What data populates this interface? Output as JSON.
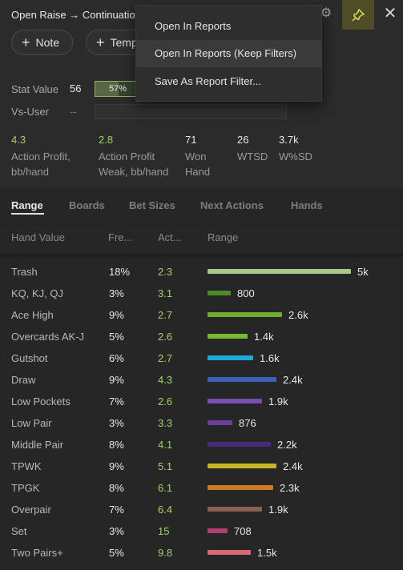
{
  "header": {
    "title": "Open Raise → Continuation",
    "note_label": "Note",
    "template_label": "Temp"
  },
  "context_menu": {
    "items": [
      "Open In Reports",
      "Open In Reports (Keep Filters)",
      "Save As Report Filter..."
    ]
  },
  "stat": {
    "stat_value_label": "Stat Value",
    "stat_value": "56",
    "percent_text": "57% w",
    "percent": 57,
    "vs_user_label": "Vs-User",
    "vs_user_value": "--"
  },
  "kpis": [
    {
      "value": "4.3",
      "label_line1": "Action Profit,",
      "label_line2": "bb/hand"
    },
    {
      "value": "2.8",
      "label_line1": "Action Profit",
      "label_line2": "Weak, bb/hand"
    },
    {
      "value": "71",
      "label_line1": "Won",
      "label_line2": "Hand"
    },
    {
      "value": "26",
      "label_line1": "WTSD",
      "label_line2": ""
    },
    {
      "value": "3.7k",
      "label_line1": "W%SD",
      "label_line2": ""
    }
  ],
  "tabs": [
    "Range",
    "Boards",
    "Bet Sizes",
    "Next Actions",
    "Hands"
  ],
  "table": {
    "headers": [
      "Hand Value",
      "Fre...",
      "Act...",
      "Range"
    ],
    "rows": [
      {
        "name": "Trash",
        "freq": "18%",
        "act": "2.3",
        "count": "5k",
        "value": 5000,
        "color": "#a6c98a"
      },
      {
        "name": "KQ, KJ, QJ",
        "freq": "3%",
        "act": "3.1",
        "count": "800",
        "value": 800,
        "color": "#4c8a2a"
      },
      {
        "name": "Ace High",
        "freq": "9%",
        "act": "2.7",
        "count": "2.6k",
        "value": 2600,
        "color": "#6fae2c"
      },
      {
        "name": "Overcards AK-J",
        "freq": "5%",
        "act": "2.6",
        "count": "1.4k",
        "value": 1400,
        "color": "#7ab832"
      },
      {
        "name": "Gutshot",
        "freq": "6%",
        "act": "2.7",
        "count": "1.6k",
        "value": 1600,
        "color": "#1fa8d8"
      },
      {
        "name": "Draw",
        "freq": "9%",
        "act": "4.3",
        "count": "2.4k",
        "value": 2400,
        "color": "#3a62b8"
      },
      {
        "name": "Low Pockets",
        "freq": "7%",
        "act": "2.6",
        "count": "1.9k",
        "value": 1900,
        "color": "#7a4fb0"
      },
      {
        "name": "Low Pair",
        "freq": "3%",
        "act": "3.3",
        "count": "876",
        "value": 876,
        "color": "#6a3fa0"
      },
      {
        "name": "Middle Pair",
        "freq": "8%",
        "act": "4.1",
        "count": "2.2k",
        "value": 2200,
        "color": "#4a2a7a"
      },
      {
        "name": "TPWK",
        "freq": "9%",
        "act": "5.1",
        "count": "2.4k",
        "value": 2400,
        "color": "#c9b425"
      },
      {
        "name": "TPGK",
        "freq": "8%",
        "act": "6.1",
        "count": "2.3k",
        "value": 2300,
        "color": "#d07a20"
      },
      {
        "name": "Overpair",
        "freq": "7%",
        "act": "6.4",
        "count": "1.9k",
        "value": 1900,
        "color": "#8a6050"
      },
      {
        "name": "Set",
        "freq": "3%",
        "act": "15",
        "count": "708",
        "value": 708,
        "color": "#b04070"
      },
      {
        "name": "Two Pairs+",
        "freq": "5%",
        "act": "9.8",
        "count": "1.5k",
        "value": 1500,
        "color": "#d86a78"
      }
    ]
  }
}
